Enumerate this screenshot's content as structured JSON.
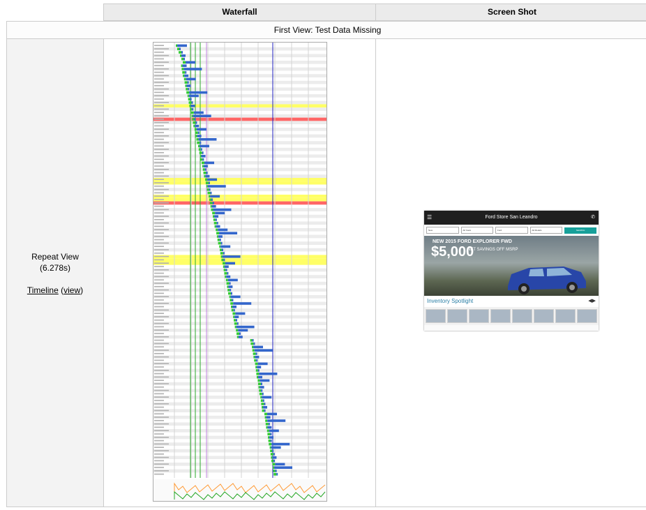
{
  "headers": {
    "waterfall": "Waterfall",
    "screenshot": "Screen Shot"
  },
  "first_view": {
    "label": "First View: Test Data Missing"
  },
  "repeat_view": {
    "title": "Repeat View",
    "time": "(6.278s)",
    "timeline_label": "Timeline",
    "view_label": "view"
  },
  "screenshot": {
    "site_title": "Ford Store San Leandro",
    "filters": [
      "New",
      "All Years",
      "Ford",
      "All Models"
    ],
    "search_label": "SEARCH",
    "promo_line": "NEW 2015 FORD EXPLORER FWD",
    "promo_amount": "$5,000",
    "promo_detail": "NET SAVINGS OFF MSRP",
    "spotlight": "Inventory Spotlight"
  },
  "colors": {
    "header_bg": "#ebebeb",
    "border": "#cccccc",
    "side_bg": "#f3f3f3",
    "bar_green": "#33cc33",
    "bar_blue": "#3366cc",
    "bar_orange": "#ff9933",
    "row_highlight_yellow": "#ffff66",
    "row_error_red": "#ff6666",
    "marker_green": "#28a828",
    "marker_purple": "#c080e0",
    "marker_blue": "#2020c0"
  },
  "waterfall_icons": [
    "waterfall-chart-icon"
  ]
}
